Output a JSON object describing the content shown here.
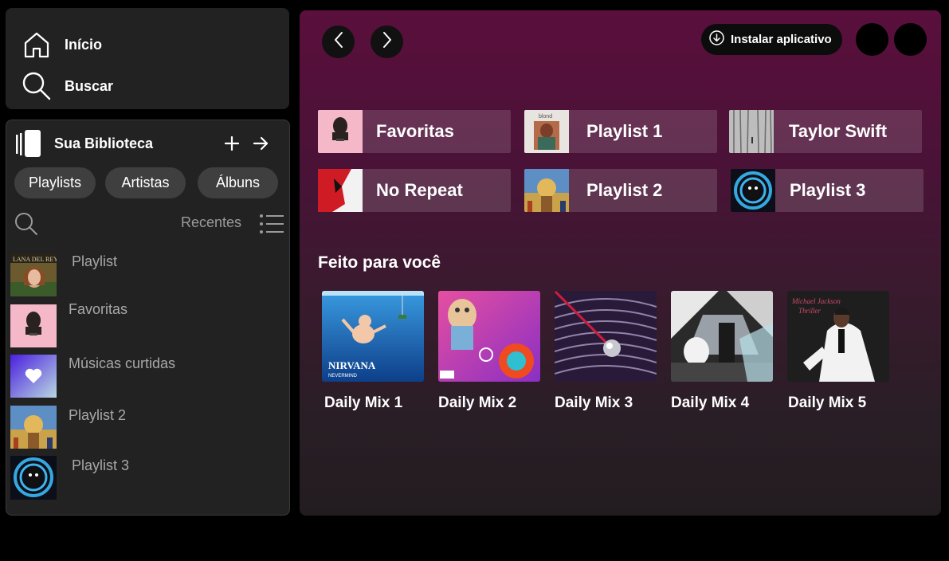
{
  "nav": {
    "home_label": "Início",
    "search_label": "Buscar"
  },
  "library": {
    "title": "Sua Biblioteca",
    "chips": [
      "Playlists",
      "Artistas",
      "Álbuns"
    ],
    "sort_label": "Recentes",
    "items": [
      {
        "name": "Playlist",
        "art": "lana-del-rey-cover"
      },
      {
        "name": "Favoritas",
        "art": "pink-cover"
      },
      {
        "name": "Músicas curtidas",
        "art": "heart-gradient"
      },
      {
        "name": "Playlist 2",
        "art": "astroworld-cover"
      },
      {
        "name": "Playlist 3",
        "art": "blue-figure-cover"
      }
    ]
  },
  "header": {
    "install_label": "Instalar aplicativo"
  },
  "quick_access": [
    {
      "name": "Favoritas",
      "art": "pink-cover"
    },
    {
      "name": "Playlist 1",
      "art": "blond-cover"
    },
    {
      "name": "Taylor Swift",
      "art": "folklore-cover"
    },
    {
      "name": "No Repeat",
      "art": "red-cover"
    },
    {
      "name": "Playlist 2",
      "art": "astroworld-cover"
    },
    {
      "name": "Playlist 3",
      "art": "blue-figure-cover"
    }
  ],
  "made_for_you": {
    "title": "Feito para você",
    "mixes": [
      {
        "name": "Daily Mix 1",
        "art": "underwater-baby-cover"
      },
      {
        "name": "Daily Mix 2",
        "art": "colorful-bear-cover"
      },
      {
        "name": "Daily Mix 3",
        "art": "psychedelic-cover"
      },
      {
        "name": "Daily Mix 4",
        "art": "black-white-cover"
      },
      {
        "name": "Daily Mix 5",
        "art": "white-suit-cover"
      }
    ]
  },
  "colors": {
    "panel": "#222222",
    "chip": "#3f3f3f",
    "main_gradient_top": "#5a0f3c",
    "muted_text": "#a8a8a8"
  }
}
